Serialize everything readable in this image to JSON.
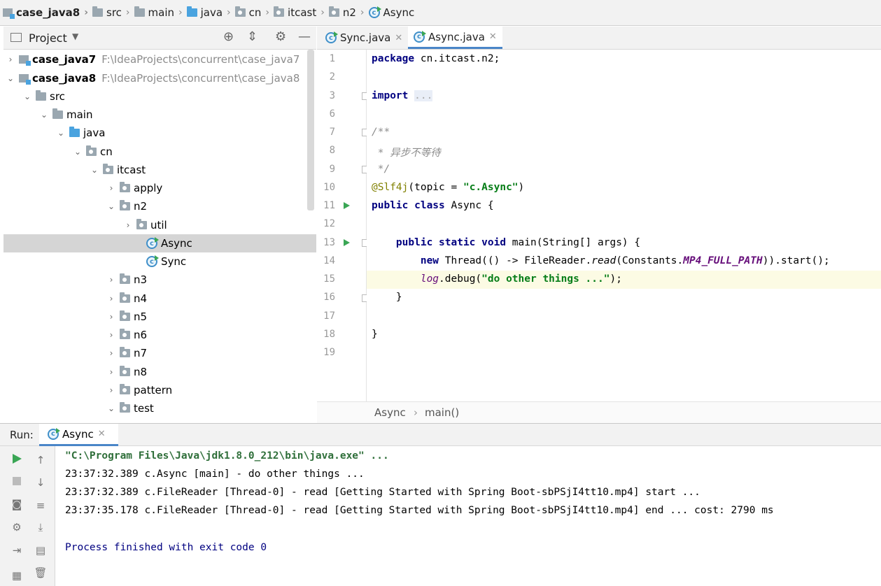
{
  "breadcrumb": [
    "case_java8",
    "src",
    "main",
    "java",
    "cn",
    "itcast",
    "n2",
    "Async"
  ],
  "project_panel": {
    "title": "Project",
    "tree": [
      {
        "label": "case_java7",
        "path": "F:\\IdeaProjects\\concurrent\\case_java7"
      },
      {
        "label": "case_java8",
        "path": "F:\\IdeaProjects\\concurrent\\case_java8"
      },
      {
        "label": "src"
      },
      {
        "label": "main"
      },
      {
        "label": "java"
      },
      {
        "label": "cn"
      },
      {
        "label": "itcast"
      },
      {
        "label": "apply"
      },
      {
        "label": "n2"
      },
      {
        "label": "util"
      },
      {
        "label": "Async"
      },
      {
        "label": "Sync"
      },
      {
        "label": "n3"
      },
      {
        "label": "n4"
      },
      {
        "label": "n5"
      },
      {
        "label": "n6"
      },
      {
        "label": "n7"
      },
      {
        "label": "n8"
      },
      {
        "label": "pattern"
      },
      {
        "label": "test"
      }
    ]
  },
  "editor": {
    "tabs": [
      "Sync.java",
      "Async.java"
    ],
    "active_tab": "Async.java",
    "line_numbers": [
      "1",
      "2",
      "3",
      "6",
      "7",
      "8",
      "9",
      "10",
      "11",
      "12",
      "13",
      "14",
      "15",
      "16",
      "17",
      "18",
      "19"
    ],
    "highlighted_line": "15",
    "breadcrumb": [
      "Async",
      "main()"
    ]
  },
  "code": {
    "l1_kw": "package",
    "l1_rest": " cn.itcast.n2;",
    "l3_kw": "import",
    "l3_fold": "...",
    "l7": "/**",
    "l8": " * 异步不等待",
    "l9": " */",
    "l10_ann": "@Slf4j",
    "l10_a": "(topic = ",
    "l10_str": "\"c.Async\"",
    "l10_b": ")",
    "l11_kw": "public class",
    "l11_rest": " Async {",
    "l13_kw": "public static void",
    "l13_rest": " main(String[] args) {",
    "l14_kw": "new",
    "l14_a": " Thread(() -> FileReader.",
    "l14_read": "read",
    "l14_b": "(Constants.",
    "l14_const": "MP4_FULL_PATH",
    "l14_c": ")).start();",
    "l15_log": "log",
    "l15_a": ".debug(",
    "l15_str": "\"do other things ...\"",
    "l15_b": ");",
    "l16": "}",
    "l18": "}"
  },
  "run_panel": {
    "label": "Run:",
    "tab": "Async",
    "console": [
      "\"C:\\Program Files\\Java\\jdk1.8.0_212\\bin\\java.exe\" ...",
      "23:37:32.389 c.Async [main] - do other things ...",
      "23:37:32.389 c.FileReader [Thread-0] - read [Getting Started with Spring Boot-sbPSjI4tt10.mp4] start ...",
      "23:37:35.178 c.FileReader [Thread-0] - read [Getting Started with Spring Boot-sbPSjI4tt10.mp4] end ... cost: 2790 ms",
      "Process finished with exit code 0"
    ]
  },
  "colors": {
    "accent": "#4a86c8",
    "keyword": "#000080",
    "string": "#067d17",
    "run_green": "#3aa655",
    "exit_text": "#000080"
  }
}
